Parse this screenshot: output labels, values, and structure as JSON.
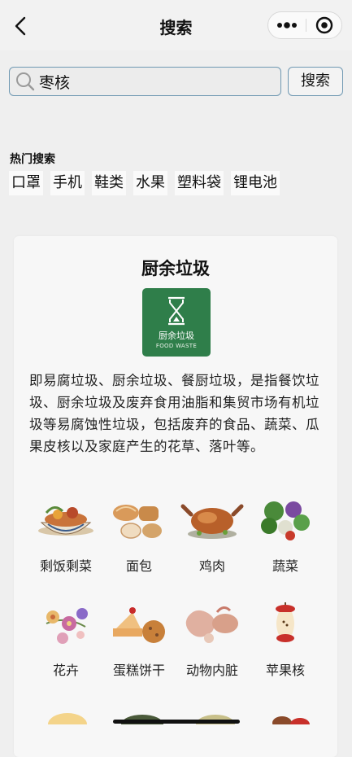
{
  "header": {
    "title": "搜索",
    "back_icon": "back-arrow-icon",
    "more_icon": "more-dots-icon",
    "close_icon": "target-close-icon"
  },
  "search": {
    "value": "枣核",
    "placeholder": "",
    "button_label": "搜索"
  },
  "hot": {
    "title": "热门搜索",
    "tags": [
      "口罩",
      "手机",
      "鞋类",
      "水果",
      "塑料袋",
      "锂电池"
    ]
  },
  "result": {
    "title": "厨余垃圾",
    "icon_cn": "厨余垃圾",
    "icon_en": "FOOD WASTE",
    "icon_color": "#2f7e4a",
    "description": "即易腐垃圾、厨余垃圾、餐厨垃圾，是指餐饮垃圾、厨余垃圾及废弃食用油脂和集贸市场有机垃圾等易腐蚀性垃圾，包括废弃的食品、蔬菜、瓜果皮核以及家庭产生的花草、落叶等。",
    "examples": [
      "剩饭剩菜",
      "面包",
      "鸡肉",
      "蔬菜",
      "花卉",
      "蛋糕饼干",
      "动物内脏",
      "苹果核"
    ]
  }
}
